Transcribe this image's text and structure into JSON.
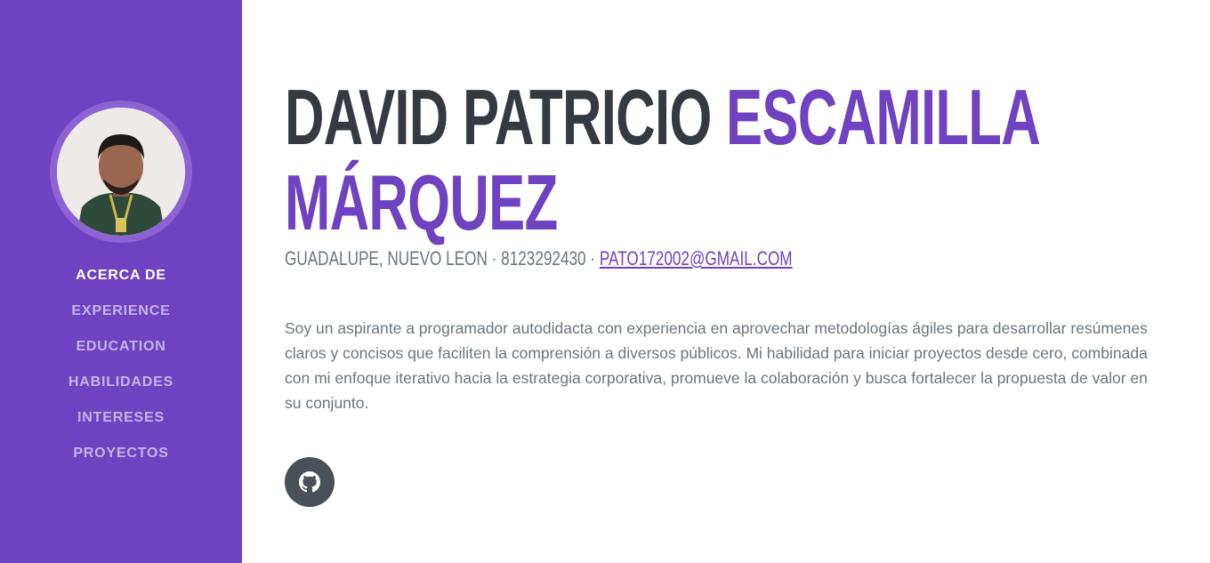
{
  "sidebar": {
    "avatar_icon": "profile-photo",
    "nav": [
      {
        "label": "ACERCA DE",
        "active": true
      },
      {
        "label": "EXPERIENCE"
      },
      {
        "label": "EDUCATION"
      },
      {
        "label": "HABILIDADES"
      },
      {
        "label": "INTERESES"
      },
      {
        "label": "PROYECTOS"
      }
    ]
  },
  "about": {
    "first_name": "DAVID PATRICIO ",
    "last_name_line1": "ESCAMILLA",
    "last_name_line2": "MÁRQUEZ",
    "location": "GUADALUPE, NUEVO LEON · 8123292430 · ",
    "email": "PATO172002@GMAIL.COM",
    "bio": "Soy un aspirante a programador autodidacta con experiencia en aprovechar metodologías ágiles para desarrollar resúmenes claros y concisos que faciliten la comprensión a diversos públicos. Mi habilidad para iniciar proyectos desde cero, combinada con mi enfoque iterativo hacia la estrategia corporativa, promueve la colaboración y busca fortalecer la propuesta de valor en su conjunto.",
    "social_icon": "github-icon"
  },
  "colors": {
    "brand": "#6f42c1",
    "dark": "#343a40",
    "muted": "#6c757d"
  }
}
